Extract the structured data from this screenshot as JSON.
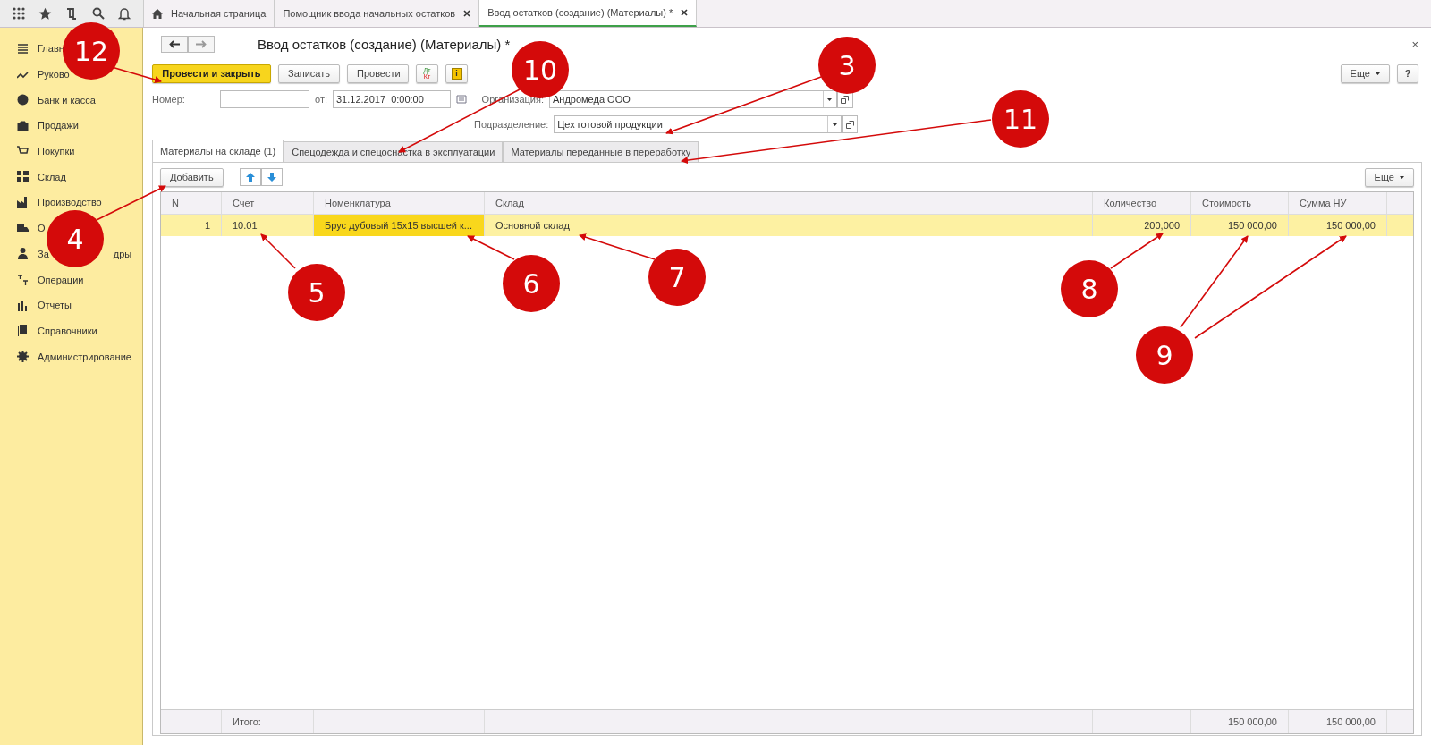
{
  "sidebar": {
    "items": [
      {
        "label": "Главн"
      },
      {
        "label": "Руково"
      },
      {
        "label": "Банк и касса"
      },
      {
        "label": "Продажи"
      },
      {
        "label": "Покупки"
      },
      {
        "label": "Склад"
      },
      {
        "label": "Производство"
      },
      {
        "label": "О"
      },
      {
        "label": "За",
        "label_tail": "дры"
      },
      {
        "label": "Операции"
      },
      {
        "label": "Отчеты"
      },
      {
        "label": "Справочники"
      },
      {
        "label": "Администрирование"
      }
    ]
  },
  "tabs": [
    {
      "label": "Начальная страница",
      "closable": false,
      "selected": false
    },
    {
      "label": "Помощник ввода начальных остатков",
      "closable": true,
      "selected": false
    },
    {
      "label": "Ввод остатков (создание) (Материалы) *",
      "closable": true,
      "selected": true
    }
  ],
  "form": {
    "title": "Ввод остатков (создание) (Материалы) *",
    "close": "×",
    "toolbar": {
      "primary": "Провести и закрыть",
      "buttons": [
        "Записать",
        "Провести"
      ],
      "dt": "Дт",
      "kt": "Кт",
      "info": "i",
      "more": "Еще",
      "help": "?"
    },
    "number": {
      "label": "Номер:"
    },
    "date": {
      "label": "от:",
      "value": "31.12.2017  0:00:00"
    },
    "organization": {
      "label": "Организация:",
      "value": "Андромеда ООО"
    },
    "department": {
      "label": "Подразделение:",
      "value": "Цех готовой продукции"
    },
    "inner_tabs": [
      {
        "label": "Материалы на складе (1)",
        "selected": true
      },
      {
        "label": "Спецодежда и спецоснастка в эксплуатации",
        "selected": false
      },
      {
        "label": "Материалы переданные в переработку",
        "selected": false
      }
    ],
    "table_toolbar": {
      "add": "Добавить",
      "more": "Еще"
    },
    "table": {
      "columns": [
        "N",
        "Счет",
        "Номенклатура",
        "Склад",
        "Количество",
        "Стоимость",
        "Сумма НУ"
      ],
      "rows": [
        {
          "cells": [
            {
              "text": "1",
              "current": false
            },
            {
              "text": "10.01",
              "current": false
            },
            {
              "text": "Брус дубовый 15х15 высшей к...",
              "current": true
            },
            {
              "text": "Основной склад",
              "current": false
            },
            {
              "text": "200,000",
              "current": false
            },
            {
              "text": "150 000,00",
              "current": false
            },
            {
              "text": "150 000,00",
              "current": false
            }
          ],
          "selected": true
        }
      ],
      "footer": {
        "label": "Итого:",
        "cost_total": "150 000,00",
        "tax_total": "150 000,00"
      }
    }
  },
  "annotations": [
    {
      "number": "12"
    },
    {
      "number": "10"
    },
    {
      "number": "3"
    },
    {
      "number": "11"
    },
    {
      "number": "4"
    },
    {
      "number": "5"
    },
    {
      "number": "6"
    },
    {
      "number": "7"
    },
    {
      "number": "8"
    },
    {
      "number": "9"
    }
  ]
}
